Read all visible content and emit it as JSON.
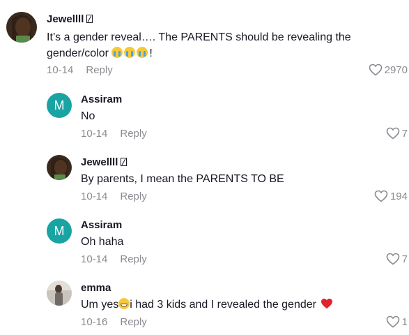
{
  "comments": [
    {
      "username": "Jewellll",
      "text_before": "It’s a gender reveal…. The PARENTS should be revealing the gender/color ",
      "text_after": "!",
      "date": "10-14",
      "reply_label": "Reply",
      "likes": "2970"
    },
    {
      "username": "Assiram",
      "avatar_initial": "M",
      "text": "No",
      "date": "10-14",
      "reply_label": "Reply",
      "likes": "7"
    },
    {
      "username": "Jewellll",
      "text": "By parents, I mean the PARENTS TO BE",
      "date": "10-14",
      "reply_label": "Reply",
      "likes": "194"
    },
    {
      "username": "Assiram",
      "avatar_initial": "M",
      "text": "Oh haha",
      "date": "10-14",
      "reply_label": "Reply",
      "likes": "7"
    },
    {
      "username": "emma",
      "text_before": "Um yes",
      "text_after": "i had 3 kids and I revealed the gender",
      "date": "10-16",
      "reply_label": "Reply",
      "likes": "1"
    }
  ],
  "colors": {
    "accent_avatar": "#1aa3a3",
    "meta_gray": "#8a8b91",
    "text": "#161823",
    "heart_red": "#e0242f"
  },
  "icons": [
    "heart-outline-icon",
    "loudly-crying-emoji",
    "grinning-sweat-emoji",
    "red-heart-emoji",
    "verified-badge-icon"
  ]
}
